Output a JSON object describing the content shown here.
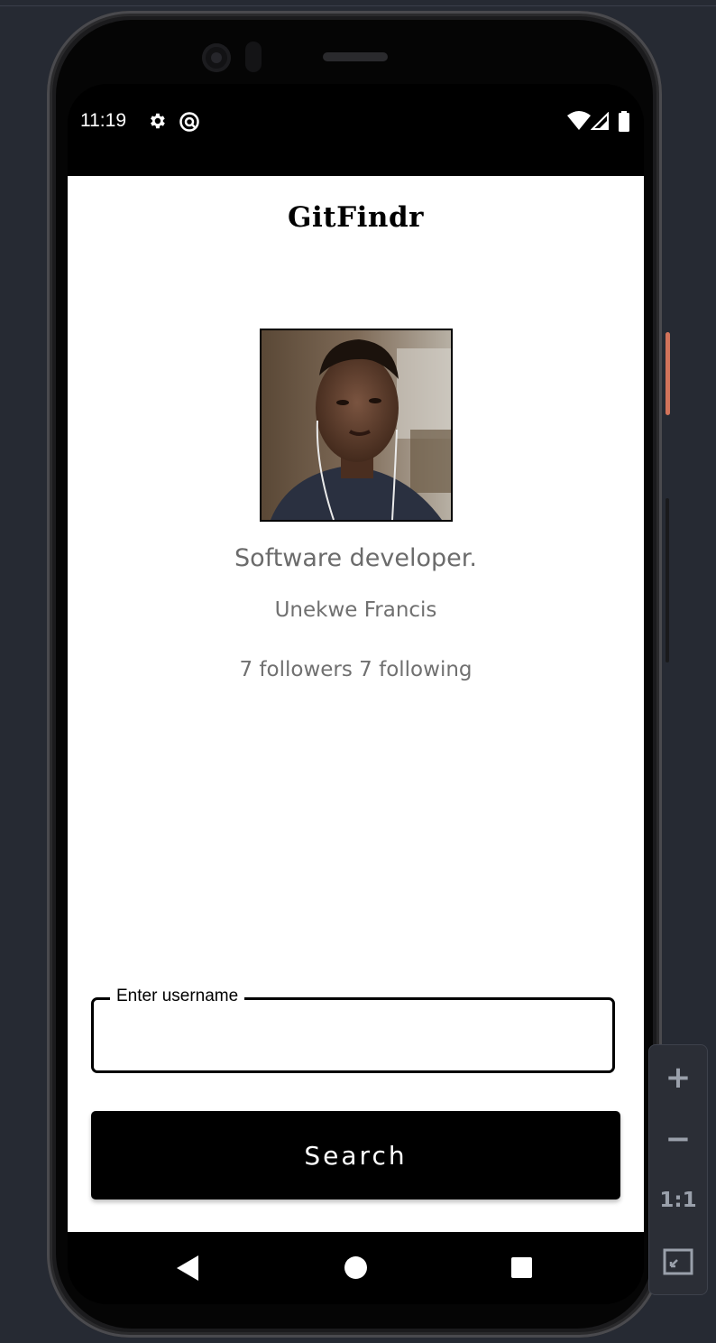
{
  "status_bar": {
    "time": "11:19",
    "left_icons": [
      "gear-icon",
      "at-sign-icon"
    ],
    "right_icons": [
      "wifi-icon",
      "signal-icon",
      "battery-icon"
    ]
  },
  "app": {
    "title": "GitFindr",
    "profile": {
      "avatar_alt": "profile photo",
      "bio": "Software developer.",
      "name": "Unekwe Francis",
      "follow_stats": "7 followers 7 following"
    },
    "search": {
      "field_label": "Enter username",
      "field_value": "",
      "button_label": "Search"
    }
  },
  "navigation_bar": {
    "buttons": [
      "back-icon",
      "home-icon",
      "recents-icon"
    ]
  },
  "emulator_zoom": {
    "zoom_in": "+",
    "zoom_out": "−",
    "actual_size": "1:1",
    "fit_icon": "fit-screen-icon"
  }
}
